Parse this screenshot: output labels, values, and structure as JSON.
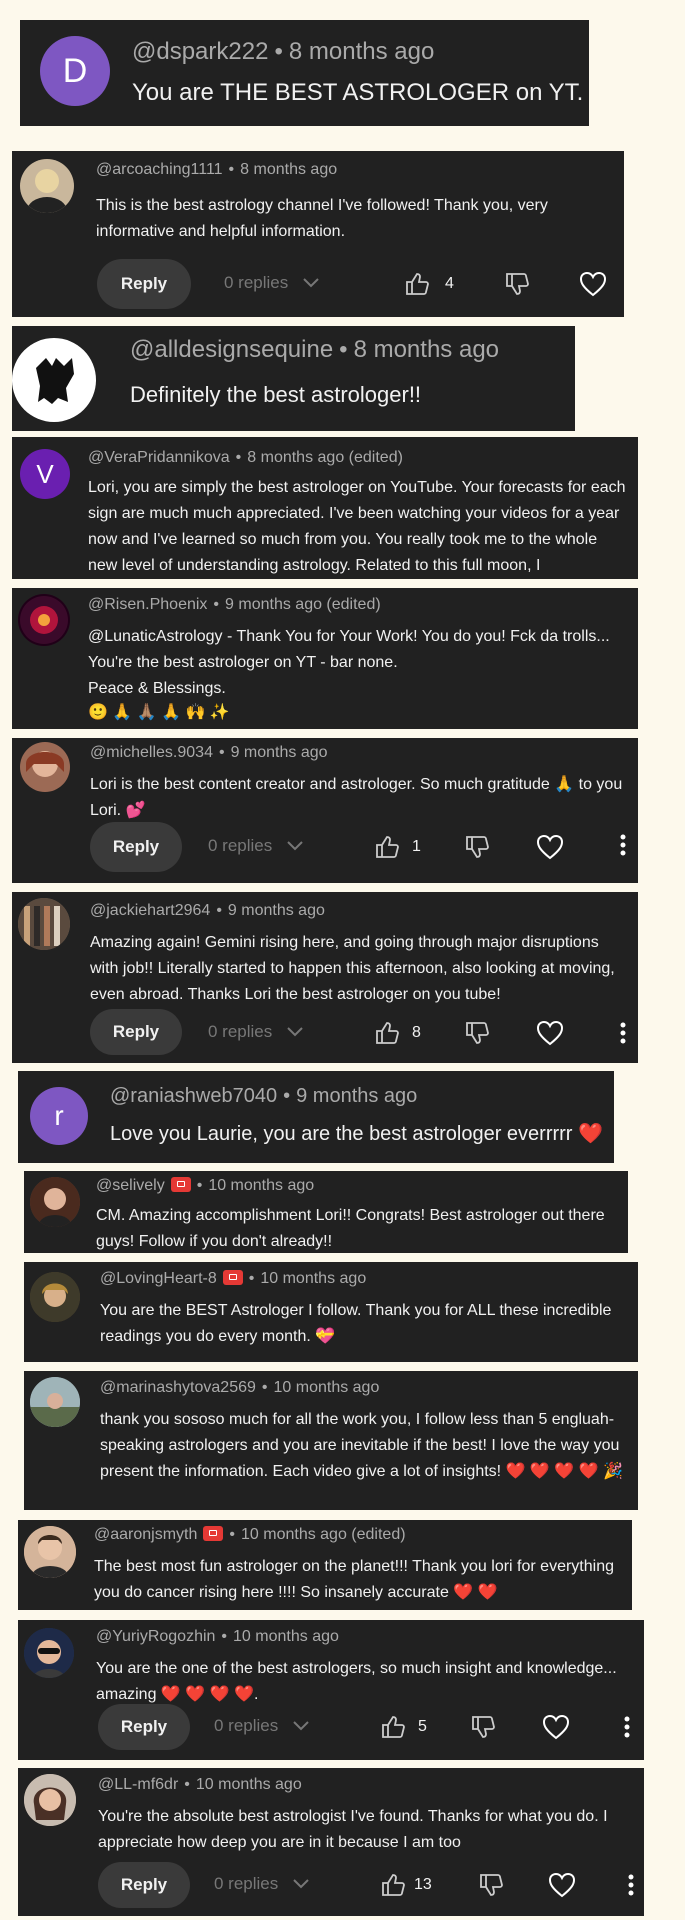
{
  "comments": [
    {
      "handle": "@dspark222",
      "time": "8 months ago",
      "text": "You are THE BEST ASTROLOGER on YT.",
      "avatar_letter": "D",
      "avatar_color": "#7e57c2"
    },
    {
      "handle": "@arcoaching1111",
      "time": "8 months ago",
      "text": "This is the best astrology channel I've followed! Thank you, very informative and helpful information.",
      "reply": "Reply",
      "replies": "0 replies",
      "likes": "4"
    },
    {
      "handle": "@alldesignsequine",
      "time": "8 months ago",
      "text": "Definitely the best astrologer!!"
    },
    {
      "handle": "@VeraPridannikova",
      "time": "8 months ago (edited)",
      "text": "Lori, you are simply the best astrologer on YouTube. Your forecasts for each sign are much much appreciated. I've been watching your videos for a year now and I've learned so much from you. You really took me to the whole new level of understanding astrology.  Related to this full moon, I",
      "avatar_letter": "V",
      "avatar_color": "#6a1fb0"
    },
    {
      "handle": "@Risen.Phoenix",
      "time": "9 months ago (edited)",
      "text": "@LunaticAstrology - Thank You for Your Work! You do you! Fck da trolls... You're the best astrologer on YT - bar none.",
      "text2": "Peace & Blessings.",
      "text3": "🙂 🙏 🙏🏽 🙏 🙌 ✨"
    },
    {
      "handle": "@michelles.9034",
      "time": "9 months ago",
      "text": "Lori is the best content creator and astrologer. So much gratitude 🙏 to you Lori. 💕",
      "reply": "Reply",
      "replies": "0 replies",
      "likes": "1"
    },
    {
      "handle": "@jackiehart2964",
      "time": "9 months ago",
      "text": "Amazing again! Gemini rising here, and going through major disruptions with job!! Literally  started to happen this afternoon, also looking at moving, even abroad. Thanks Lori the best astrologer on you tube!",
      "reply": "Reply",
      "replies": "0 replies",
      "likes": "8"
    },
    {
      "handle": "@raniashweb7040",
      "time": "9 months ago",
      "text": "Love you Laurie, you are the best astrologer everrrrr ❤️",
      "avatar_letter": "r",
      "avatar_color": "#7e57c2"
    },
    {
      "handle": "@selively",
      "time": "10 months ago",
      "text": "CM. Amazing accomplishment Lori!! Congrats! Best astrologer out there guys! Follow if you don't already!!"
    },
    {
      "handle": "@LovingHeart-8",
      "time": "10 months ago",
      "text": "You are the BEST Astrologer I follow. Thank you for ALL these incredible readings you do every month. 💝"
    },
    {
      "handle": "@marinashytova2569",
      "time": "10 months ago",
      "text": "thank you sososo much for all the work you, I follow less than 5 engluah-speaking astrologers and you are inevitable if the best!  I love the way you present the information. Each video give a lot of insights! ❤️ ❤️ ❤️ ❤️ 🎉"
    },
    {
      "handle": "@aaronjsmyth",
      "time": "10 months ago (edited)",
      "text": "The best most fun astrologer on the planet!!! Thank you lori for everything you do cancer rising here !!!! So insanely accurate ❤️ ❤️"
    },
    {
      "handle": "@YuriyRogozhin",
      "time": "10 months ago",
      "text": "You are the one of the best astrologers, so much insight and knowledge... amazing ❤️ ❤️ ❤️ ❤️.",
      "reply": "Reply",
      "replies": "0 replies",
      "likes": "5"
    },
    {
      "handle": "@LL-mf6dr",
      "time": "10 months ago",
      "text": "You're the absolute best astrologist I've found. Thanks for what you do. I appreciate how deep you are in it because I am too",
      "reply": "Reply",
      "replies": "0 replies",
      "likes": "13"
    }
  ],
  "colors": {
    "card_bg": "#212121",
    "page_bg": "#fdf9ec",
    "handle": "#aaaaaa",
    "text": "#f1f1f1",
    "badge": "#e53935"
  }
}
